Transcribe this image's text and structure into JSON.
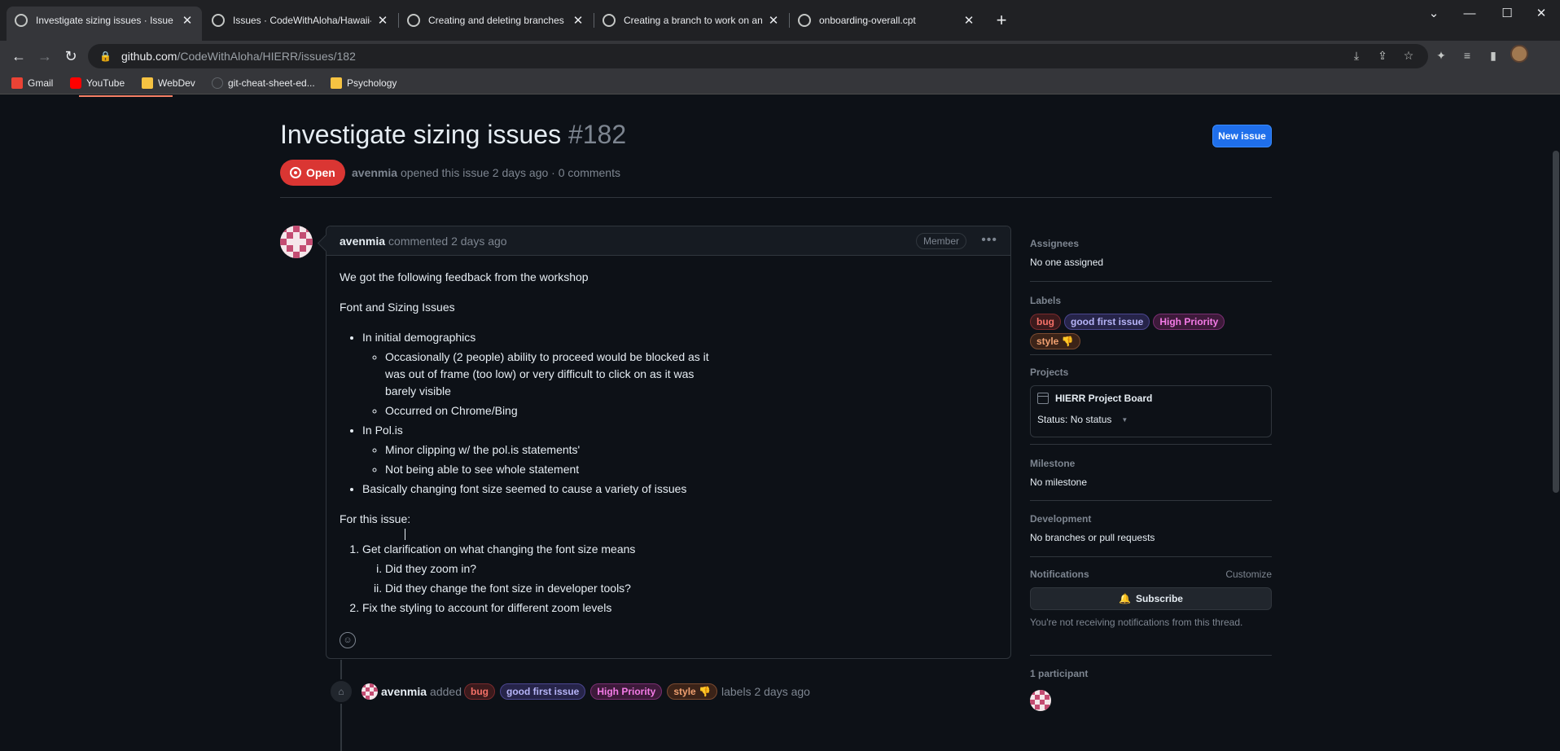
{
  "browser": {
    "tabs": [
      {
        "title": "Investigate sizing issues · Issue #",
        "active": true
      },
      {
        "title": "Issues · CodeWithAloha/Hawaii-",
        "active": false
      },
      {
        "title": "Creating and deleting branches ",
        "active": false
      },
      {
        "title": "Creating a branch to work on an",
        "active": false
      },
      {
        "title": "onboarding-overall.cpt",
        "active": false
      }
    ],
    "url_host": "github.com",
    "url_path": "/CodeWithAloha/HIERR/issues/182",
    "bookmarks": [
      "Gmail",
      "YouTube",
      "WebDev",
      "git-cheat-sheet-ed...",
      "Psychology"
    ]
  },
  "issue": {
    "title": "Investigate sizing issues",
    "number": "#182",
    "state": "Open",
    "new_issue_label": "New issue",
    "author": "avenmia",
    "meta_text": "opened this issue 2 days ago · 0 comments"
  },
  "comment": {
    "author": "avenmia",
    "action": "commented 2 days ago",
    "role": "Member",
    "intro": "We got the following feedback from the workshop",
    "section_heading": "Font and Sizing Issues",
    "bullets": {
      "b1": "In initial demographics",
      "b1_1": "Occasionally (2 people) ability to proceed would be blocked as it was out of frame (too low) or very difficult to click on as it was barely visible",
      "b1_2": "Occurred on Chrome/Bing",
      "b2": "In Pol.is",
      "b2_1": "Minor clipping w/ the pol.is statements'",
      "b2_2": "Not being able to see whole statement",
      "b3": "Basically changing font size seemed to cause a variety of issues"
    },
    "for_issue": "For this issue:",
    "steps": {
      "s1": "Get clarification on what changing the font size means",
      "s1_1": "Did they zoom in?",
      "s1_2": "Did they change the font size in developer tools?",
      "s2": "Fix the styling to account for different zoom levels"
    }
  },
  "labels": {
    "bug": "bug",
    "good_first_issue": "good first issue",
    "high_priority": "High Priority",
    "style": "style 👎"
  },
  "timeline": {
    "author": "avenmia",
    "verb": "added",
    "suffix": "labels 2 days ago"
  },
  "sidebar": {
    "assignees": {
      "heading": "Assignees",
      "value": "No one assigned"
    },
    "labels_heading": "Labels",
    "projects": {
      "heading": "Projects",
      "name": "HIERR Project Board",
      "status": "Status: No status"
    },
    "milestone": {
      "heading": "Milestone",
      "value": "No milestone"
    },
    "development": {
      "heading": "Development",
      "value": "No branches or pull requests"
    },
    "notifications": {
      "heading": "Notifications",
      "customize": "Customize",
      "subscribe": "Subscribe",
      "note": "You're not receiving notifications from this thread."
    },
    "participants": {
      "heading": "1 participant"
    }
  },
  "colors": {
    "accent": "#1f6feb",
    "open_state": "#da3633",
    "background": "#0d1117"
  }
}
